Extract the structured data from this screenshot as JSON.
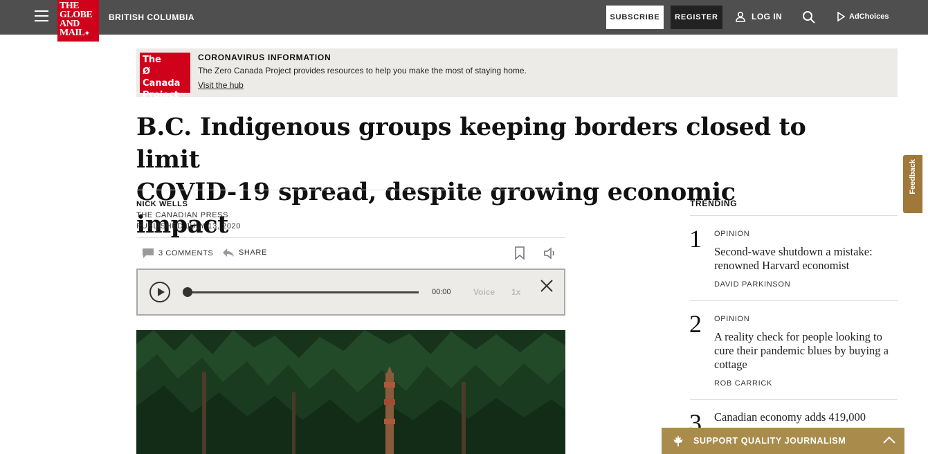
{
  "header": {
    "logo_lines": [
      "THE",
      "GLOBE",
      "AND",
      "MAIL"
    ],
    "region": "BRITISH COLUMBIA",
    "subscribe_label": "SUBSCRIBE",
    "register_label": "REGISTER",
    "login_label": "LOG IN",
    "adchoices_label": "AdChoices",
    "colors": {
      "bar": "#4f4f4f",
      "brand_red": "#d0021b"
    }
  },
  "banner": {
    "logo_lines": [
      "The",
      "Ø Canada",
      "Project"
    ],
    "title": "CORONAVIRUS INFORMATION",
    "text": "The Zero Canada Project provides resources to help you make the most of staying home.",
    "link": "Visit the hub"
  },
  "article": {
    "headline_line1": "B.C. Indigenous groups keeping borders closed to limit",
    "headline_line2": "COVID-19 spread, despite growing economic impact",
    "author": "NICK WELLS",
    "source": "THE CANADIAN PRESS",
    "published": "PUBLISHED JULY 13, 2020",
    "comments_label": "3 COMMENTS",
    "share_label": "SHARE"
  },
  "player": {
    "time": "00:00",
    "voice_label": "Voice",
    "speed_label": "1x",
    "progress": 0
  },
  "trending": {
    "title": "TRENDING",
    "items": [
      {
        "num": "1",
        "label": "OPINION",
        "title": "Second-wave shutdown a mistake: renowned Harvard economist",
        "author": "DAVID PARKINSON"
      },
      {
        "num": "2",
        "label": "OPINION",
        "title": "A reality check for people looking to cure their pandemic blues by buying a cottage",
        "author": "ROB CARRICK"
      },
      {
        "num": "3",
        "label": "",
        "title": "Canadian economy adds 419,000",
        "author": ""
      }
    ]
  },
  "feedback_label": "Feedback",
  "support_label": "SUPPORT QUALITY JOURNALISM"
}
